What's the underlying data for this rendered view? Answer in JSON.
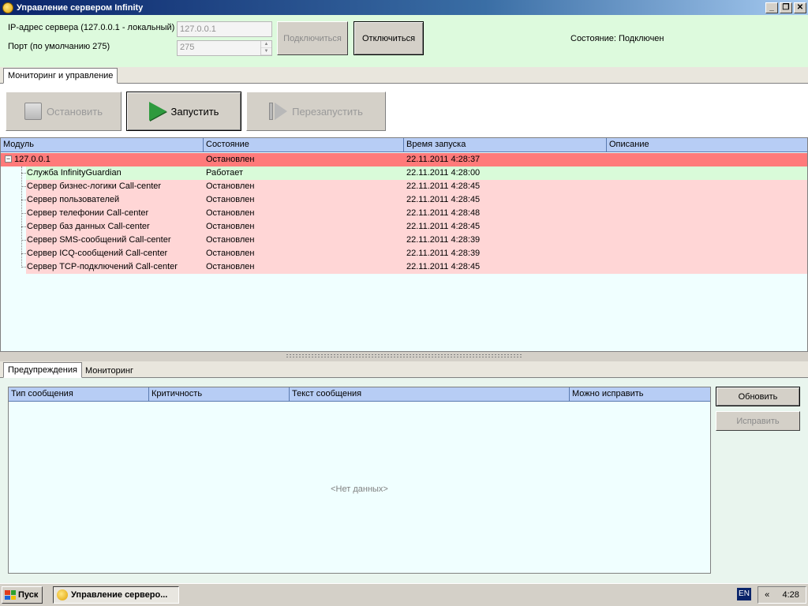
{
  "window": {
    "title": "Управление сервером Infinity",
    "controls": {
      "minimize": "_",
      "restore": "❐",
      "close": "✕"
    }
  },
  "connection": {
    "ip_label": "IP-адрес сервера (127.0.0.1 - локальный)",
    "ip_value": "127.0.0.1",
    "port_label": "Порт (по умолчанию 275)",
    "port_value": "275",
    "connect_button": "Подключиться",
    "disconnect_button": "Отключиться",
    "status_text": "Состояние: Подключен"
  },
  "top_tabs": [
    {
      "label": "Мониторинг и управление"
    }
  ],
  "toolbar": {
    "stop_label": "Остановить",
    "start_label": "Запустить",
    "restart_label": "Перезапустить"
  },
  "modules_table": {
    "columns": [
      "Модуль",
      "Состояние",
      "Время запуска",
      "Описание"
    ],
    "root": {
      "module": "127.0.0.1",
      "state": "Остановлен",
      "time": "22.11.2011 4:28:37",
      "expander": "−"
    },
    "rows": [
      {
        "module": "Служба InfinityGuardian",
        "state": "Работает",
        "time": "22.11.2011 4:28:00",
        "status": "running"
      },
      {
        "module": "Сервер бизнес-логики Call-center",
        "state": "Остановлен",
        "time": "22.11.2011 4:28:45",
        "status": "stopped"
      },
      {
        "module": "Сервер пользователей",
        "state": "Остановлен",
        "time": "22.11.2011 4:28:45",
        "status": "stopped"
      },
      {
        "module": "Сервер телефонии Call-center",
        "state": "Остановлен",
        "time": "22.11.2011 4:28:48",
        "status": "stopped"
      },
      {
        "module": "Сервер баз данных Call-center",
        "state": "Остановлен",
        "time": "22.11.2011 4:28:45",
        "status": "stopped"
      },
      {
        "module": "Сервер SMS-сообщений Call-center",
        "state": "Остановлен",
        "time": "22.11.2011 4:28:39",
        "status": "stopped"
      },
      {
        "module": "Сервер ICQ-сообщений Call-center",
        "state": "Остановлен",
        "time": "22.11.2011 4:28:39",
        "status": "stopped"
      },
      {
        "module": "Сервер TCP-подключений Call-center",
        "state": "Остановлен",
        "time": "22.11.2011 4:28:45",
        "status": "stopped"
      }
    ]
  },
  "bottom_tabs": [
    {
      "label": "Предупреждения"
    },
    {
      "label": "Мониторинг"
    }
  ],
  "warnings_table": {
    "columns": [
      "Тип сообщения",
      "Критичность",
      "Текст сообщения",
      "Можно исправить"
    ],
    "empty_text": "<Нет данных>"
  },
  "side_buttons": {
    "refresh": "Обновить",
    "fix": "Исправить"
  },
  "taskbar": {
    "start_label": "Пуск",
    "task_label": "Управление серверо...",
    "lang": "EN",
    "chevron": "«",
    "clock": "4:28"
  },
  "colors": {
    "connection_bg": "#ddfadd",
    "root_row_bg": "#ff7a7a",
    "running_row_bg": "#d9fbd9",
    "stopped_row_bg": "#ffd6d6",
    "grid_bg": "#f0ffff",
    "header_bg": "#b7cdf5"
  }
}
